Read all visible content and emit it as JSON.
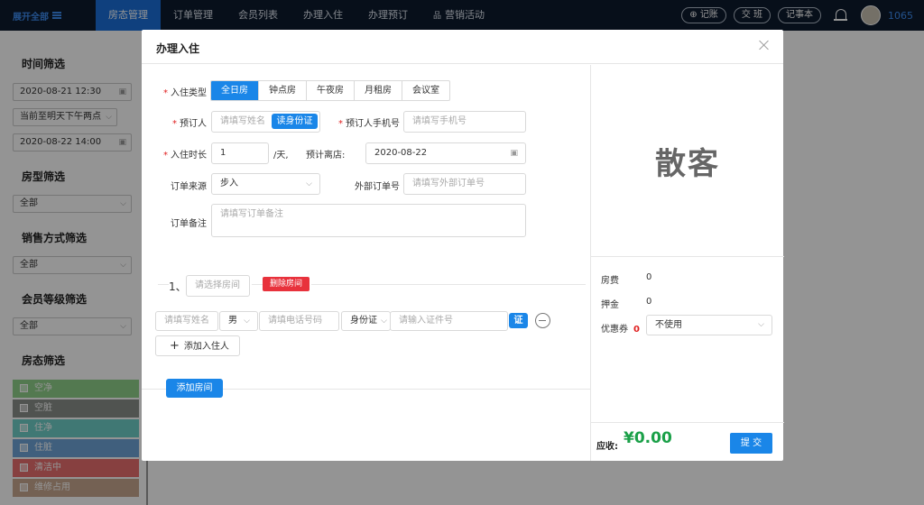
{
  "nav": {
    "logo_text": "展开全部",
    "items": [
      "房态管理",
      "订单管理",
      "会员列表",
      "办理入住",
      "办理预订",
      "营销活动"
    ],
    "right_buttons": [
      "记账",
      "交 班",
      "记事本"
    ],
    "user_id": "1065"
  },
  "sidebar": {
    "time_title": "时间筛选",
    "start_time": "2020-08-21 12:30",
    "time_preset": "当前至明天下午两点",
    "end_time": "2020-08-22 14:00",
    "room_type_title": "房型筛选",
    "room_type_value": "全部",
    "sale_title": "销售方式筛选",
    "sale_value": "全部",
    "member_title": "会员等级筛选",
    "member_value": "全部",
    "status_title": "房态筛选",
    "statuses": [
      {
        "label": "空净",
        "color": "#8fd08a"
      },
      {
        "label": "空脏",
        "color": "#8a8f8a"
      },
      {
        "label": "住净",
        "color": "#6fcfc9"
      },
      {
        "label": "住脏",
        "color": "#6ea4d8"
      },
      {
        "label": "清洁中",
        "color": "#e86e6e"
      },
      {
        "label": "维修占用",
        "color": "#c9a890"
      }
    ]
  },
  "modal": {
    "title": "办理入住",
    "checkin_type_label": "入住类型",
    "checkin_types": [
      "全日房",
      "钟点房",
      "午夜房",
      "月租房",
      "会议室"
    ],
    "booker_label": "预订人",
    "booker_placeholder": "请填写姓名",
    "read_id_button": "读身份证",
    "booker_phone_label": "预订人手机号",
    "booker_phone_placeholder": "请填写手机号",
    "duration_label": "入住时长",
    "duration_value": "1",
    "duration_unit": "/天,",
    "leave_label": "预计离店:",
    "leave_date": "2020-08-22",
    "source_label": "订单来源",
    "source_value": "步入",
    "external_label": "外部订单号",
    "external_placeholder": "请填写外部订单号",
    "remark_label": "订单备注",
    "remark_placeholder": "请填写订单备注",
    "room_index": "1、",
    "room_placeholder": "请选择房间",
    "delete_room_button": "删除房间",
    "guest": {
      "name_placeholder": "请填写姓名",
      "gender": "男",
      "phone_placeholder": "请填电话号码",
      "id_type": "身份证",
      "id_placeholder": "请输入证件号",
      "id_button": "证"
    },
    "add_guest_button": "添加入住人",
    "add_room_button": "添加房间",
    "customer_tag": "散客",
    "room_fee_label": "房费",
    "room_fee_value": "0",
    "deposit_label": "押金",
    "deposit_value": "0",
    "coupon_label": "优惠券",
    "coupon_count": "0",
    "coupon_value": "不使用",
    "total_label": "应收:",
    "total_value": "¥0.00",
    "submit_button": "提 交"
  }
}
